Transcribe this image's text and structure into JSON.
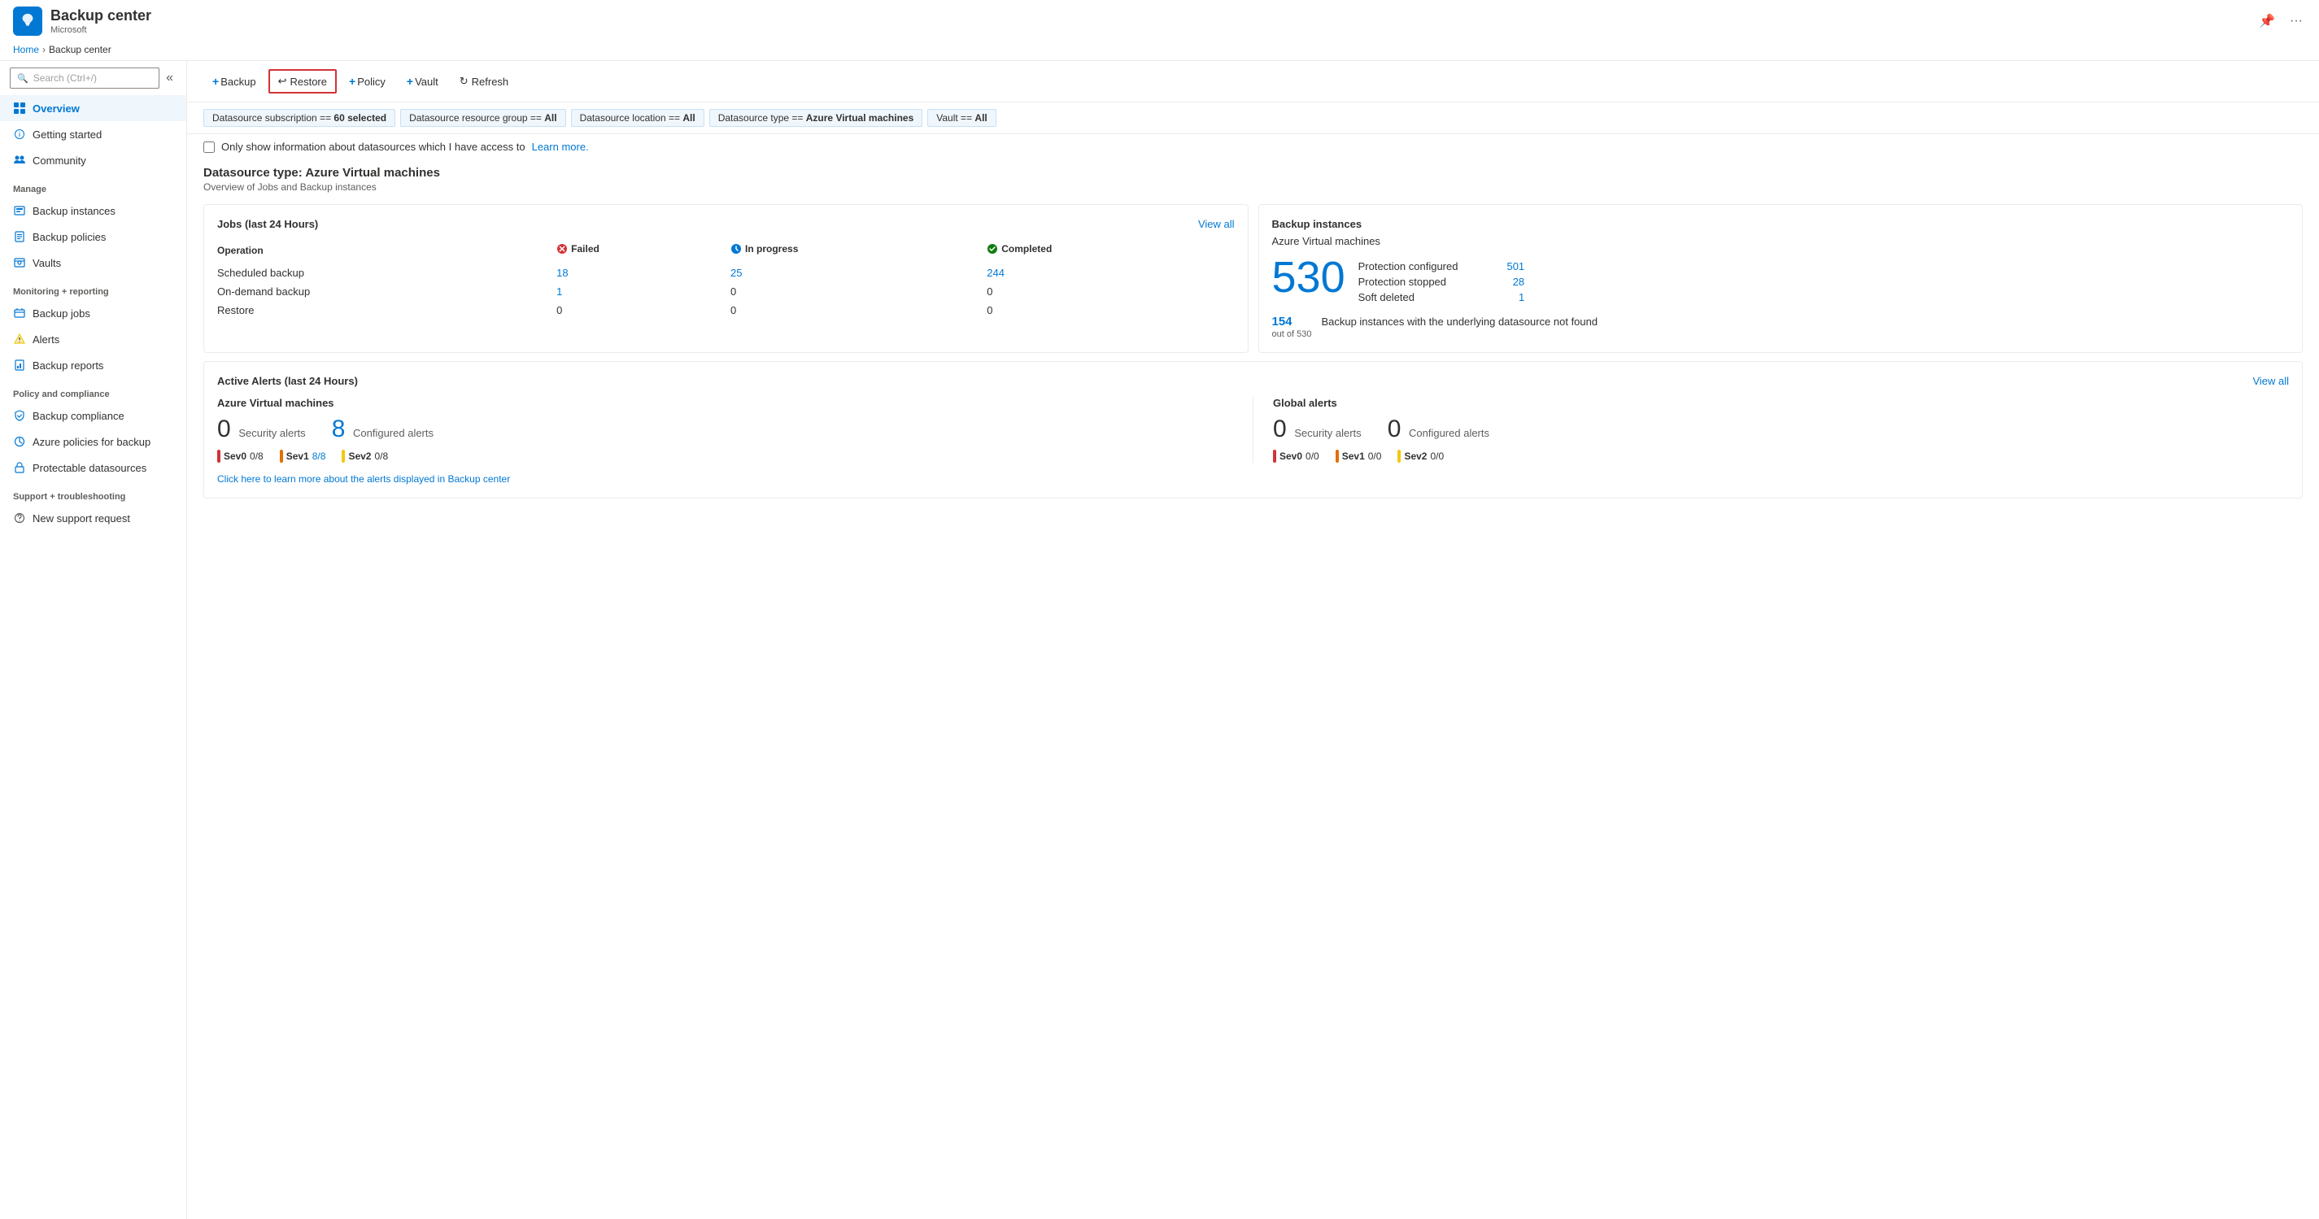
{
  "app": {
    "title": "Backup center",
    "subtitle": "Microsoft",
    "icon_alt": "backup-center-icon"
  },
  "breadcrumb": {
    "items": [
      "Home",
      "Backup center"
    ]
  },
  "toolbar": {
    "backup_label": "+ Backup",
    "restore_label": "Restore",
    "policy_label": "+ Policy",
    "vault_label": "+ Vault",
    "refresh_label": "Refresh"
  },
  "filters": [
    {
      "label": "Datasource subscription == ",
      "value": "60 selected"
    },
    {
      "label": "Datasource resource group == ",
      "value": "All"
    },
    {
      "label": "Datasource location == ",
      "value": "All"
    },
    {
      "label": "Datasource type == ",
      "value": "Azure Virtual machines"
    },
    {
      "label": "Vault == ",
      "value": "All"
    }
  ],
  "checkbox": {
    "label": "Only show information about datasources which I have access to",
    "link_label": "Learn more."
  },
  "section": {
    "title": "Datasource type: Azure Virtual machines",
    "subtitle": "Overview of Jobs and Backup instances"
  },
  "jobs_card": {
    "title": "Jobs (last 24 Hours)",
    "view_all": "View all",
    "col_operation": "Operation",
    "col_failed": "Failed",
    "col_inprogress": "In progress",
    "col_completed": "Completed",
    "rows": [
      {
        "operation": "Scheduled backup",
        "failed": "18",
        "inprogress": "25",
        "completed": "244",
        "failed_link": true,
        "inprogress_link": true,
        "completed_link": true
      },
      {
        "operation": "On-demand backup",
        "failed": "1",
        "inprogress": "0",
        "completed": "0",
        "failed_link": true,
        "inprogress_link": false,
        "completed_link": false
      },
      {
        "operation": "Restore",
        "failed": "0",
        "inprogress": "0",
        "completed": "0",
        "failed_link": false,
        "inprogress_link": false,
        "completed_link": false
      }
    ]
  },
  "backup_instances_card": {
    "title": "Backup instances",
    "subtitle": "Azure Virtual machines",
    "total": "530",
    "protection_configured_label": "Protection configured",
    "protection_configured_value": "501",
    "protection_stopped_label": "Protection stopped",
    "protection_stopped_value": "28",
    "soft_deleted_label": "Soft deleted",
    "soft_deleted_value": "1",
    "underlying_count": "154",
    "underlying_label": "out of 530",
    "underlying_desc": "Backup instances with the underlying datasource not found"
  },
  "alerts_card": {
    "title": "Active Alerts (last 24 Hours)",
    "view_all": "View all",
    "azure_col": {
      "title": "Azure Virtual machines",
      "security_count": "0",
      "security_label": "Security alerts",
      "configured_count": "8",
      "configured_label": "Configured alerts",
      "sev": [
        {
          "label": "Sev0",
          "value": "0/8",
          "color": "red",
          "link": false
        },
        {
          "label": "Sev1",
          "value": "8/8",
          "color": "orange",
          "link": true
        },
        {
          "label": "Sev2",
          "value": "0/8",
          "color": "yellow",
          "link": false
        }
      ]
    },
    "global_col": {
      "title": "Global alerts",
      "security_count": "0",
      "security_label": "Security alerts",
      "configured_count": "0",
      "configured_label": "Configured alerts",
      "sev": [
        {
          "label": "Sev0",
          "value": "0/0",
          "color": "red",
          "link": false
        },
        {
          "label": "Sev1",
          "value": "0/0",
          "color": "orange",
          "link": false
        },
        {
          "label": "Sev2",
          "value": "0/0",
          "color": "yellow",
          "link": false
        }
      ]
    },
    "info_link": "Click here to learn more about the alerts displayed in Backup center"
  },
  "sidebar": {
    "search_placeholder": "Search (Ctrl+/)",
    "nav_items": [
      {
        "id": "overview",
        "label": "Overview",
        "active": true,
        "icon": "overview"
      },
      {
        "id": "getting-started",
        "label": "Getting started",
        "active": false,
        "icon": "getting-started"
      },
      {
        "id": "community",
        "label": "Community",
        "active": false,
        "icon": "community"
      }
    ],
    "manage_section": "Manage",
    "manage_items": [
      {
        "id": "backup-instances",
        "label": "Backup instances",
        "icon": "backup-instances"
      },
      {
        "id": "backup-policies",
        "label": "Backup policies",
        "icon": "backup-policies"
      },
      {
        "id": "vaults",
        "label": "Vaults",
        "icon": "vaults"
      }
    ],
    "monitoring_section": "Monitoring + reporting",
    "monitoring_items": [
      {
        "id": "backup-jobs",
        "label": "Backup jobs",
        "icon": "backup-jobs"
      },
      {
        "id": "alerts",
        "label": "Alerts",
        "icon": "alerts"
      },
      {
        "id": "backup-reports",
        "label": "Backup reports",
        "icon": "backup-reports"
      }
    ],
    "policy_section": "Policy and compliance",
    "policy_items": [
      {
        "id": "backup-compliance",
        "label": "Backup compliance",
        "icon": "backup-compliance"
      },
      {
        "id": "azure-policies",
        "label": "Azure policies for backup",
        "icon": "azure-policies"
      },
      {
        "id": "protectable",
        "label": "Protectable datasources",
        "icon": "protectable"
      }
    ],
    "support_section": "Support + troubleshooting",
    "support_items": [
      {
        "id": "new-support",
        "label": "New support request",
        "icon": "support"
      }
    ]
  }
}
